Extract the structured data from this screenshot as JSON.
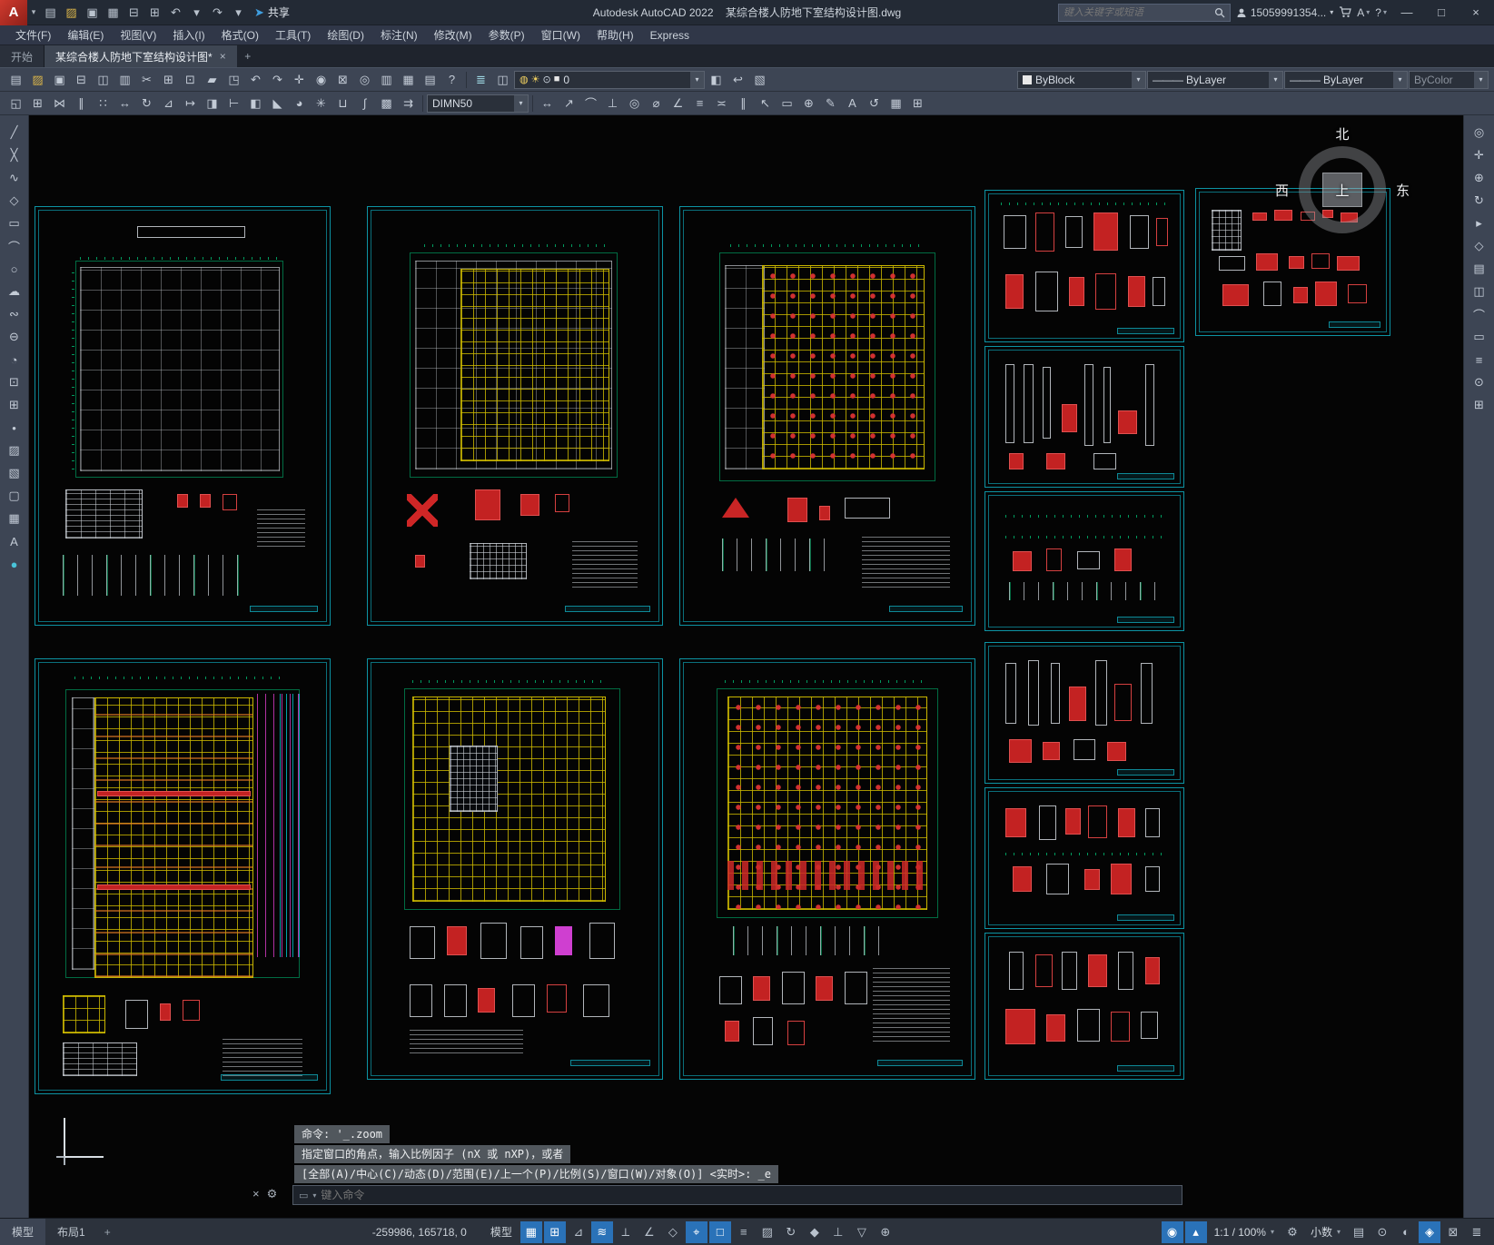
{
  "titlebar": {
    "logo_letter": "A",
    "logo_arrow": "▾",
    "share_label": "共享",
    "app_title": "Autodesk AutoCAD 2022",
    "doc_title": "某综合楼人防地下室结构设计图.dwg",
    "search_placeholder": "键入关键字或短语",
    "account_label": "15059991354...",
    "account_dropdown": "▾",
    "apps_label": "A",
    "help_label": "?",
    "dropdown_arrow": "▾",
    "minimize_glyph": "—",
    "maximize_glyph": "□",
    "close_glyph": "×"
  },
  "quick_access": {
    "share_plane_glyph": "➤",
    "icons": [
      {
        "name": "new-file-icon",
        "glyph": "▤"
      },
      {
        "name": "open-folder-icon",
        "glyph": "▨",
        "color": "#d9b44a"
      },
      {
        "name": "save-icon",
        "glyph": "▣"
      },
      {
        "name": "save-as-icon",
        "glyph": "▦"
      },
      {
        "name": "plot-icon",
        "glyph": "⊟"
      },
      {
        "name": "batch-plot-icon",
        "glyph": "⊞"
      },
      {
        "name": "undo-icon",
        "glyph": "↶"
      },
      {
        "name": "undo-dropdown-icon",
        "glyph": "▾"
      },
      {
        "name": "redo-icon",
        "glyph": "↷"
      },
      {
        "name": "redo-dropdown-icon",
        "glyph": "▾"
      }
    ]
  },
  "menubar": {
    "items": [
      {
        "label": "文件(F)"
      },
      {
        "label": "编辑(E)"
      },
      {
        "label": "视图(V)"
      },
      {
        "label": "插入(I)"
      },
      {
        "label": "格式(O)"
      },
      {
        "label": "工具(T)"
      },
      {
        "label": "绘图(D)"
      },
      {
        "label": "标注(N)"
      },
      {
        "label": "修改(M)"
      },
      {
        "label": "参数(P)"
      },
      {
        "label": "窗口(W)"
      },
      {
        "label": "帮助(H)"
      },
      {
        "label": "Express"
      }
    ]
  },
  "tabbar": {
    "start_tab": "开始",
    "doc_tab": "某综合楼人防地下室结构设计图*",
    "close_glyph": "×",
    "add_glyph": "+"
  },
  "toolbar1": {
    "std_icons": [
      {
        "name": "qnew-icon",
        "glyph": "▤"
      },
      {
        "name": "open-icon",
        "glyph": "▨",
        "color": "#d9b44a"
      },
      {
        "name": "qsave-icon",
        "glyph": "▣"
      },
      {
        "name": "plot-icon",
        "glyph": "⊟"
      },
      {
        "name": "plot-preview-icon",
        "glyph": "◫"
      },
      {
        "name": "publish-icon",
        "glyph": "▥"
      },
      {
        "name": "cut-icon",
        "glyph": "✂"
      },
      {
        "name": "copy-clip-icon",
        "glyph": "⊞"
      },
      {
        "name": "paste-icon",
        "glyph": "⊡"
      },
      {
        "name": "match-properties-icon",
        "glyph": "▰"
      },
      {
        "name": "block-editor-icon",
        "glyph": "◳"
      },
      {
        "name": "undo-icon",
        "glyph": "↶"
      },
      {
        "name": "redo-icon",
        "glyph": "↷"
      },
      {
        "name": "pan-realtime-icon",
        "glyph": "✛"
      },
      {
        "name": "zoom-realtime-icon",
        "glyph": "◉"
      },
      {
        "name": "zoom-window-icon",
        "glyph": "⊠"
      },
      {
        "name": "zoom-previous-icon",
        "glyph": "◎"
      },
      {
        "name": "properties-palette-icon",
        "glyph": "▥"
      },
      {
        "name": "design-center-icon",
        "glyph": "▦"
      },
      {
        "name": "tool-palettes-icon",
        "glyph": "▤"
      },
      {
        "name": "help-icon",
        "glyph": "?"
      }
    ],
    "layer_tool_icons": [
      {
        "name": "layer-properties-manager-icon",
        "glyph": "≣",
        "color": "#9fd8e4"
      },
      {
        "name": "layer-states-icon",
        "glyph": "◫"
      }
    ],
    "layer_combo": {
      "icons": [
        {
          "name": "layer-on-icon",
          "glyph": "◍",
          "color": "#f0d060"
        },
        {
          "name": "layer-thaw-icon",
          "glyph": "☀",
          "color": "#f0d060"
        },
        {
          "name": "layer-unlock-icon",
          "glyph": "⊙",
          "color": "#c9d2dd"
        },
        {
          "name": "layer-color-swatch",
          "glyph": "■",
          "color": "#e8e8e8"
        }
      ],
      "value": "0",
      "arrow": "▾"
    },
    "layer_post_icons": [
      {
        "name": "make-current-layer-icon",
        "glyph": "◧"
      },
      {
        "name": "layer-previous-icon",
        "glyph": "↩"
      },
      {
        "name": "layer-isolate-icon",
        "glyph": "▧"
      }
    ],
    "color_combo": {
      "value": "ByBlock",
      "arrow": "▾"
    },
    "linetype_combo": {
      "value": "ByLayer",
      "arrow": "▾",
      "line": "———"
    },
    "lineweight_combo": {
      "value": "ByLayer",
      "arrow": "▾",
      "line": "———"
    },
    "plotstyle_combo": {
      "value": "ByColor",
      "arrow": "▾"
    }
  },
  "toolbar2": {
    "left_icons": [
      {
        "name": "erase-icon",
        "glyph": "◱"
      },
      {
        "name": "copy-icon",
        "glyph": "⊞"
      },
      {
        "name": "mirror-icon",
        "glyph": "⋈"
      },
      {
        "name": "offset-icon",
        "glyph": "∥"
      },
      {
        "name": "array-icon",
        "glyph": "∷"
      },
      {
        "name": "move-icon",
        "glyph": "↔"
      },
      {
        "name": "rotate-icon",
        "glyph": "↻"
      },
      {
        "name": "scale-icon",
        "glyph": "⊿"
      },
      {
        "name": "stretch-icon",
        "glyph": "↦"
      },
      {
        "name": "trim-icon",
        "glyph": "◨"
      },
      {
        "name": "extend-icon",
        "glyph": "⊢"
      },
      {
        "name": "break-icon",
        "glyph": "◧"
      },
      {
        "name": "chamfer-icon",
        "glyph": "◣"
      },
      {
        "name": "fillet-icon",
        "glyph": "◕"
      },
      {
        "name": "explode-icon",
        "glyph": "✳"
      },
      {
        "name": "join-icon",
        "glyph": "⊔"
      },
      {
        "name": "edit-polyline-icon",
        "glyph": "∫"
      },
      {
        "name": "edit-hatch-icon",
        "glyph": "▩"
      },
      {
        "name": "align-icon",
        "glyph": "⇉"
      }
    ],
    "dim_combo": {
      "value": "DIMN50",
      "arrow": "▾"
    },
    "right_icons": [
      {
        "name": "dim-linear-icon",
        "glyph": "↔"
      },
      {
        "name": "dim-aligned-icon",
        "glyph": "↗"
      },
      {
        "name": "dim-arc-length-icon",
        "glyph": "⌒"
      },
      {
        "name": "dim-ordinate-icon",
        "glyph": "⊥"
      },
      {
        "name": "dim-radius-icon",
        "glyph": "◎"
      },
      {
        "name": "dim-diameter-icon",
        "glyph": "⌀"
      },
      {
        "name": "dim-angular-icon",
        "glyph": "∠"
      },
      {
        "name": "quick-dim-icon",
        "glyph": "≡"
      },
      {
        "name": "dim-baseline-icon",
        "glyph": "≍"
      },
      {
        "name": "dim-continue-icon",
        "glyph": "∥"
      },
      {
        "name": "dim-leader-icon",
        "glyph": "↖"
      },
      {
        "name": "tolerance-icon",
        "glyph": "▭"
      },
      {
        "name": "center-mark-icon",
        "glyph": "⊕"
      },
      {
        "name": "dim-edit-icon",
        "glyph": "✎"
      },
      {
        "name": "dim-text-edit-icon",
        "glyph": "A"
      },
      {
        "name": "dim-update-icon",
        "glyph": "↺"
      },
      {
        "name": "dim-style-icon",
        "glyph": "▦"
      },
      {
        "name": "table-icon",
        "glyph": "⊞"
      }
    ]
  },
  "left_toolbar": {
    "icons": [
      {
        "name": "line-tool-icon",
        "glyph": "╱"
      },
      {
        "name": "xline-tool-icon",
        "glyph": "╳"
      },
      {
        "name": "polyline-tool-icon",
        "glyph": "∿"
      },
      {
        "name": "polygon-tool-icon",
        "glyph": "◇"
      },
      {
        "name": "rectangle-tool-icon",
        "glyph": "▭"
      },
      {
        "name": "arc-tool-icon",
        "glyph": "⌒"
      },
      {
        "name": "circle-tool-icon",
        "glyph": "○"
      },
      {
        "name": "revcloud-tool-icon",
        "glyph": "☁"
      },
      {
        "name": "spline-tool-icon",
        "glyph": "∾"
      },
      {
        "name": "ellipse-tool-icon",
        "glyph": "⊖"
      },
      {
        "name": "ellipse-arc-tool-icon",
        "glyph": "◔"
      },
      {
        "name": "insert-block-icon",
        "glyph": "⊡"
      },
      {
        "name": "create-block-icon",
        "glyph": "⊞"
      },
      {
        "name": "point-tool-icon",
        "glyph": "•"
      },
      {
        "name": "hatch-tool-icon",
        "glyph": "▨"
      },
      {
        "name": "gradient-tool-icon",
        "glyph": "▧"
      },
      {
        "name": "region-tool-icon",
        "glyph": "▢"
      },
      {
        "name": "table-tool-icon",
        "glyph": "▦"
      },
      {
        "name": "mtext-tool-icon",
        "glyph": "A"
      },
      {
        "name": "point-style-icon",
        "glyph": "●",
        "color": "#49c3d8"
      }
    ]
  },
  "right_toolbar": {
    "icons": [
      {
        "name": "steering-wheel-icon",
        "glyph": "◎"
      },
      {
        "name": "pan-hand-icon",
        "glyph": "✛"
      },
      {
        "name": "zoom-extents-icon",
        "glyph": "⊕"
      },
      {
        "name": "orbit-icon",
        "glyph": "↻"
      },
      {
        "name": "show-motion-icon",
        "glyph": "▸"
      },
      {
        "name": "viewcube-toggle-icon",
        "glyph": "◇"
      },
      {
        "name": "navbar-icon",
        "glyph": "▤"
      },
      {
        "name": "layer-walk-icon",
        "glyph": "◫"
      },
      {
        "name": "measure-distance-icon",
        "glyph": "⌒"
      },
      {
        "name": "measure-area-icon",
        "glyph": "▭"
      },
      {
        "name": "list-info-icon",
        "glyph": "≡"
      },
      {
        "name": "id-point-icon",
        "glyph": "⊙"
      },
      {
        "name": "quick-calc-icon",
        "glyph": "⊞"
      }
    ]
  },
  "viewcube": {
    "north": "北",
    "west": "西",
    "east": "东",
    "up": "上"
  },
  "command": {
    "history": [
      {
        "text": "命令: '_.zoom"
      },
      {
        "text": "指定窗口的角点，输入比例因子 (nX 或 nXP)，或者"
      },
      {
        "text": "[全部(A)/中心(C)/动态(D)/范围(E)/上一个(P)/比例(S)/窗口(W)/对象(O)] <实时>: _e"
      }
    ],
    "input_placeholder": "键入命令",
    "close_glyph": "×",
    "customize_glyph": "⚙",
    "prompt_box_glyph": "▭",
    "recent_glyph": "▾"
  },
  "statusbar": {
    "model_tab": "模型",
    "layout_tab": "布局1",
    "add_tab": "+",
    "coords": "-259986, 165718, 0",
    "model_toggle": "模型",
    "left_icons": [
      {
        "name": "grid-display-icon",
        "glyph": "▦",
        "active": true
      },
      {
        "name": "snap-mode-icon",
        "glyph": "⊞",
        "active": true
      },
      {
        "name": "infer-constraints-icon",
        "glyph": "⊿"
      },
      {
        "name": "dynamic-input-icon",
        "glyph": "≋",
        "active": true
      },
      {
        "name": "ortho-mode-icon",
        "glyph": "⟂"
      },
      {
        "name": "polar-tracking-icon",
        "glyph": "∠"
      },
      {
        "name": "isodraft-icon",
        "glyph": "◇"
      },
      {
        "name": "object-snap-tracking-icon",
        "glyph": "⌖",
        "active": true
      },
      {
        "name": "object-snap-icon",
        "glyph": "□",
        "active": true
      },
      {
        "name": "lineweight-display-icon",
        "glyph": "≡"
      },
      {
        "name": "transparency-icon",
        "glyph": "▨"
      },
      {
        "name": "selection-cycling-icon",
        "glyph": "↻"
      },
      {
        "name": "3d-osnap-icon",
        "glyph": "◆"
      },
      {
        "name": "dynamic-ucs-icon",
        "glyph": "⊥"
      },
      {
        "name": "selection-filter-icon",
        "glyph": "▽"
      },
      {
        "name": "gizmo-icon",
        "glyph": "⊕"
      }
    ],
    "pre_scale_icons": [
      {
        "name": "annotation-visibility-icon",
        "glyph": "◉",
        "active": true
      },
      {
        "name": "autoscale-icon",
        "glyph": "▴",
        "active": true
      }
    ],
    "scale_combo": {
      "value": "1:1 / 100%",
      "arrow": "▾"
    },
    "mid_icons": [
      {
        "name": "annotation-scale-gear-icon",
        "glyph": "⚙"
      }
    ],
    "units_combo": {
      "value": "小数",
      "arrow": "▾"
    },
    "right_icons": [
      {
        "name": "quick-properties-icon",
        "glyph": "▤"
      },
      {
        "name": "lock-ui-icon",
        "glyph": "⊙"
      },
      {
        "name": "isolate-objects-icon",
        "glyph": "◐"
      },
      {
        "name": "graphics-performance-icon",
        "glyph": "◈",
        "active": true
      },
      {
        "name": "clean-screen-icon",
        "glyph": "⊠"
      },
      {
        "name": "customization-icon",
        "glyph": "≣"
      }
    ]
  }
}
